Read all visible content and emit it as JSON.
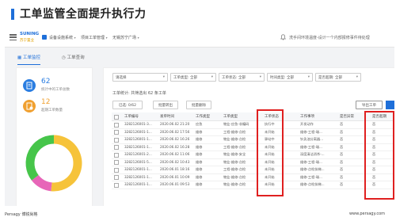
{
  "slide": {
    "title": "工单监管全面提升执行力"
  },
  "app": {
    "logo_top": "SUNING",
    "logo_bottom": "苏宁置业",
    "breadcrumbs": [
      "设备设施系统",
      "项目工单管理",
      "无锡苏宁广场"
    ],
    "notice": "洗手间环境温度-设计一个内部报修事件待处理",
    "tabs": [
      "工单监控",
      "工单查询"
    ]
  },
  "summary": {
    "total_value": "62",
    "total_label": "统计中的工单总数",
    "overdue_value": "12",
    "overdue_label": "超期工单数量"
  },
  "donut": {
    "segments": [
      {
        "value": 32,
        "color": "#f6c33a"
      },
      {
        "value": 8,
        "color": "#e766b8"
      },
      {
        "value": 22,
        "color": "#46c54a"
      }
    ]
  },
  "filters": [
    {
      "label": "请选择",
      "caret": "▾"
    },
    {
      "label": "工单类型: 全部",
      "caret": "▾"
    },
    {
      "label": "工单状态: 全部",
      "caret": "▾"
    },
    {
      "label": "时间类型: 全部",
      "caret": "▾"
    },
    {
      "label": "是否超期: 全部",
      "caret": "▾"
    }
  ],
  "stats_line": "工单统计: 共筛选出 62 条工单",
  "buttons": {
    "selected": "已选: 0/62",
    "batch_transfer": "批量转出",
    "batch_delete": "批量删除",
    "export": "导出工单"
  },
  "table": {
    "columns": [
      "工单编号",
      "发单时间",
      "工作类型",
      "工单类型",
      "工单状态",
      "工作事项",
      "是否异常",
      "是否超期"
    ],
    "rows": [
      [
        "3282126001-3...",
        "2020.06.02 21:20",
        "应急",
        "物业-应急-非编码",
        "执行中",
        "开发动作",
        "否",
        "否"
      ],
      [
        "3282126001-1...",
        "2020.06.02 17:56",
        "维修",
        "工程-维修-点检",
        "未开始",
        "维修-工程-瑞...",
        "否",
        "否"
      ],
      [
        "3282126001-1...",
        "2020.06.02 16:26",
        "维修",
        "物业-维修-点检",
        "驿站中",
        "针灸油分离器...",
        "否",
        "否"
      ],
      [
        "3282126001-1...",
        "2020.06.02 16:28",
        "维修",
        "工程-维修-点检",
        "未开始",
        "维修-工程-瑞...",
        "否",
        "否"
      ],
      [
        "3282126001-2...",
        "2020.06.02 11:06",
        "维修",
        "物业-维修-安全",
        "未开始",
        "深度清洁消杀-...",
        "否",
        "否"
      ],
      [
        "3282126001-5...",
        "2020.06.02 10:43",
        "维修",
        "物业-维修-点检",
        "未开始",
        "维修-工程-瑞...",
        "否",
        "否"
      ],
      [
        "3282126001-1...",
        "2020.06.01 18:16",
        "维修",
        "工程-维修-点检",
        "未开始",
        "维修-点检扶梯...",
        "否",
        "否"
      ],
      [
        "3282126001-1...",
        "2020.06.01 10:09",
        "维修",
        "物业-维修-点检",
        "未开始",
        "维修-工程-瑞...",
        "否",
        "否"
      ],
      [
        "3282126001-1...",
        "2020.06.01 09:53",
        "维修",
        "物业-维修-点检",
        "未开始",
        "维修-点检扶梯...",
        "否",
        "否"
      ]
    ]
  },
  "footer": {
    "left": "Persagy 博锐尚格",
    "right": "www.persagy.com"
  },
  "colors": {
    "accent": "#1e6fd9",
    "highlight": "#e02020",
    "blue_icon": "#2a7de1",
    "orange_icon": "#f0a030"
  }
}
